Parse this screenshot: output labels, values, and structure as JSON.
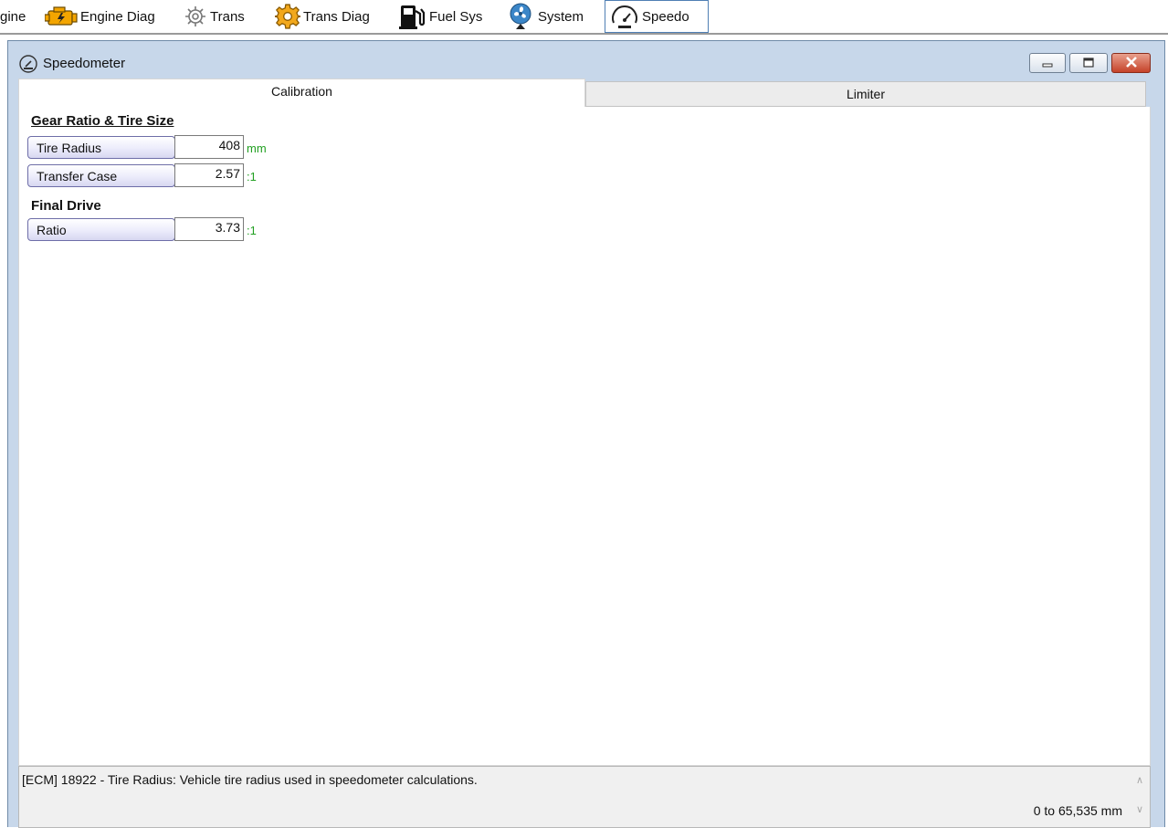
{
  "toolbar": {
    "items": [
      {
        "label": "gine",
        "icon": "none"
      },
      {
        "label": "Engine Diag",
        "icon": "engine-icon"
      },
      {
        "label": "Trans",
        "icon": "gear-outline-icon"
      },
      {
        "label": "Trans Diag",
        "icon": "gear-gold-icon"
      },
      {
        "label": "Fuel Sys",
        "icon": "fuel-pump-icon"
      },
      {
        "label": "System",
        "icon": "fan-icon"
      },
      {
        "label": "Speedo",
        "icon": "speedometer-icon",
        "active": true
      }
    ]
  },
  "window": {
    "title": "Speedometer",
    "title_icon": "speedometer-icon",
    "controls": [
      "minimize",
      "maximize",
      "close"
    ]
  },
  "tabs": [
    {
      "label": "Calibration",
      "active": true
    },
    {
      "label": "Limiter",
      "active": false
    }
  ],
  "calibration": {
    "section1_title": "Gear Ratio & Tire Size",
    "tire_radius": {
      "label": "Tire Radius",
      "value": "408",
      "unit": "mm"
    },
    "transfer_case": {
      "label": "Transfer Case",
      "value": "2.57",
      "unit": ":1"
    },
    "section2_title": "Final Drive",
    "ratio": {
      "label": "Ratio",
      "value": "3.73",
      "unit": ":1"
    }
  },
  "status": {
    "description": "[ECM] 18922 - Tire Radius: Vehicle tire radius used in speedometer calculations.",
    "range": "0 to 65,535 mm"
  },
  "colors": {
    "unit_text": "#22a022",
    "window_frame": "#c7d7ea",
    "active_tab_border": "#4f7fb4",
    "close_button": "#c5432a"
  }
}
